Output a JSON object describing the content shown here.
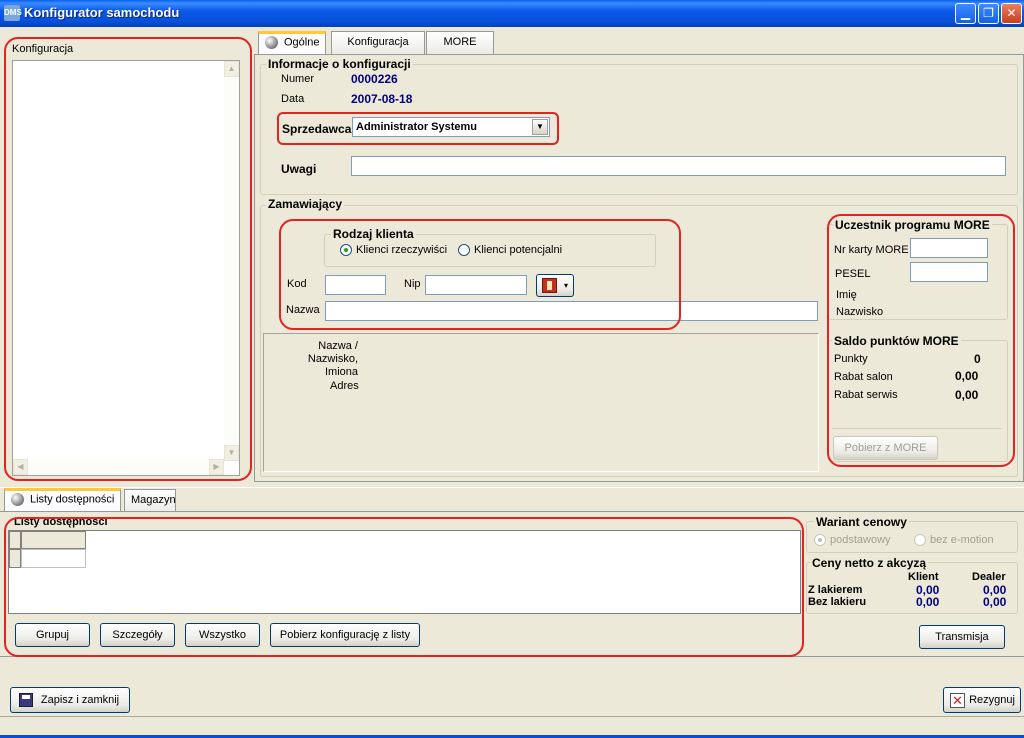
{
  "window": {
    "title": "Konfigurator samochodu",
    "icon_text": "DMS"
  },
  "left_panel": {
    "label": "Konfiguracja"
  },
  "top_tabs": [
    {
      "label": "Ogólne"
    },
    {
      "label": "Konfiguracja"
    },
    {
      "label": "MORE"
    }
  ],
  "info": {
    "group_title": "Informacje o konfiguracji",
    "numer_label": "Numer",
    "numer_value": "0000226",
    "data_label": "Data",
    "data_value": "2007-08-18",
    "sprzedawca_label": "Sprzedawca",
    "sprzedawca_value": "Administrator Systemu",
    "uwagi_label": "Uwagi",
    "uwagi_value": ""
  },
  "zamawiajacy": {
    "group_title": "Zamawiający",
    "rodzaj_title": "Rodzaj klienta",
    "radio1": "Klienci rzeczywiści",
    "radio2": "Klienci potencjalni",
    "kod_label": "Kod",
    "kod_value": "",
    "nip_label": "Nip",
    "nip_value": "",
    "nazwa_label": "Nazwa",
    "nazwa_value": "",
    "nazwa_info_label": "Nazwa /\nNazwisko, Imiona",
    "adres_label": "Adres"
  },
  "more": {
    "group_title": "Uczestnik programu MORE",
    "nr_karty_label": "Nr karty MORE",
    "pesel_label": "PESEL",
    "imie_label": "Imię",
    "nazwisko_label": "Nazwisko",
    "saldo_title": "Saldo punktów MORE",
    "punkty_label": "Punkty",
    "punkty_value": "0",
    "rabat_salon_label": "Rabat salon",
    "rabat_salon_value": "0,00",
    "rabat_serwis_label": "Rabat serwis",
    "rabat_serwis_value": "0,00",
    "pobierz_button": "Pobierz z MORE"
  },
  "bottom_tabs": [
    {
      "label": "Listy dostępności"
    },
    {
      "label": "Magazyn"
    }
  ],
  "listy": {
    "group_title": "Listy dostępności",
    "btn_grupuj": "Grupuj",
    "btn_szczegoly": "Szczegóły",
    "btn_wszystko": "Wszystko",
    "btn_pobierz": "Pobierz konfigurację z listy"
  },
  "wariant": {
    "group_title": "Wariant cenowy",
    "radio1": "podstawowy",
    "radio2": "bez e-motion"
  },
  "ceny": {
    "group_title": "Ceny netto z akcyzą",
    "col_klient": "Klient",
    "col_dealer": "Dealer",
    "row1_label": "Z lakierem",
    "row1_klient": "0,00",
    "row1_dealer": "0,00",
    "row2_label": "Bez lakieru",
    "row2_klient": "0,00",
    "row2_dealer": "0,00"
  },
  "footer": {
    "transmisja": "Transmisja",
    "zapisz": "Zapisz i zamknij",
    "rezygnuj": "Rezygnuj"
  }
}
